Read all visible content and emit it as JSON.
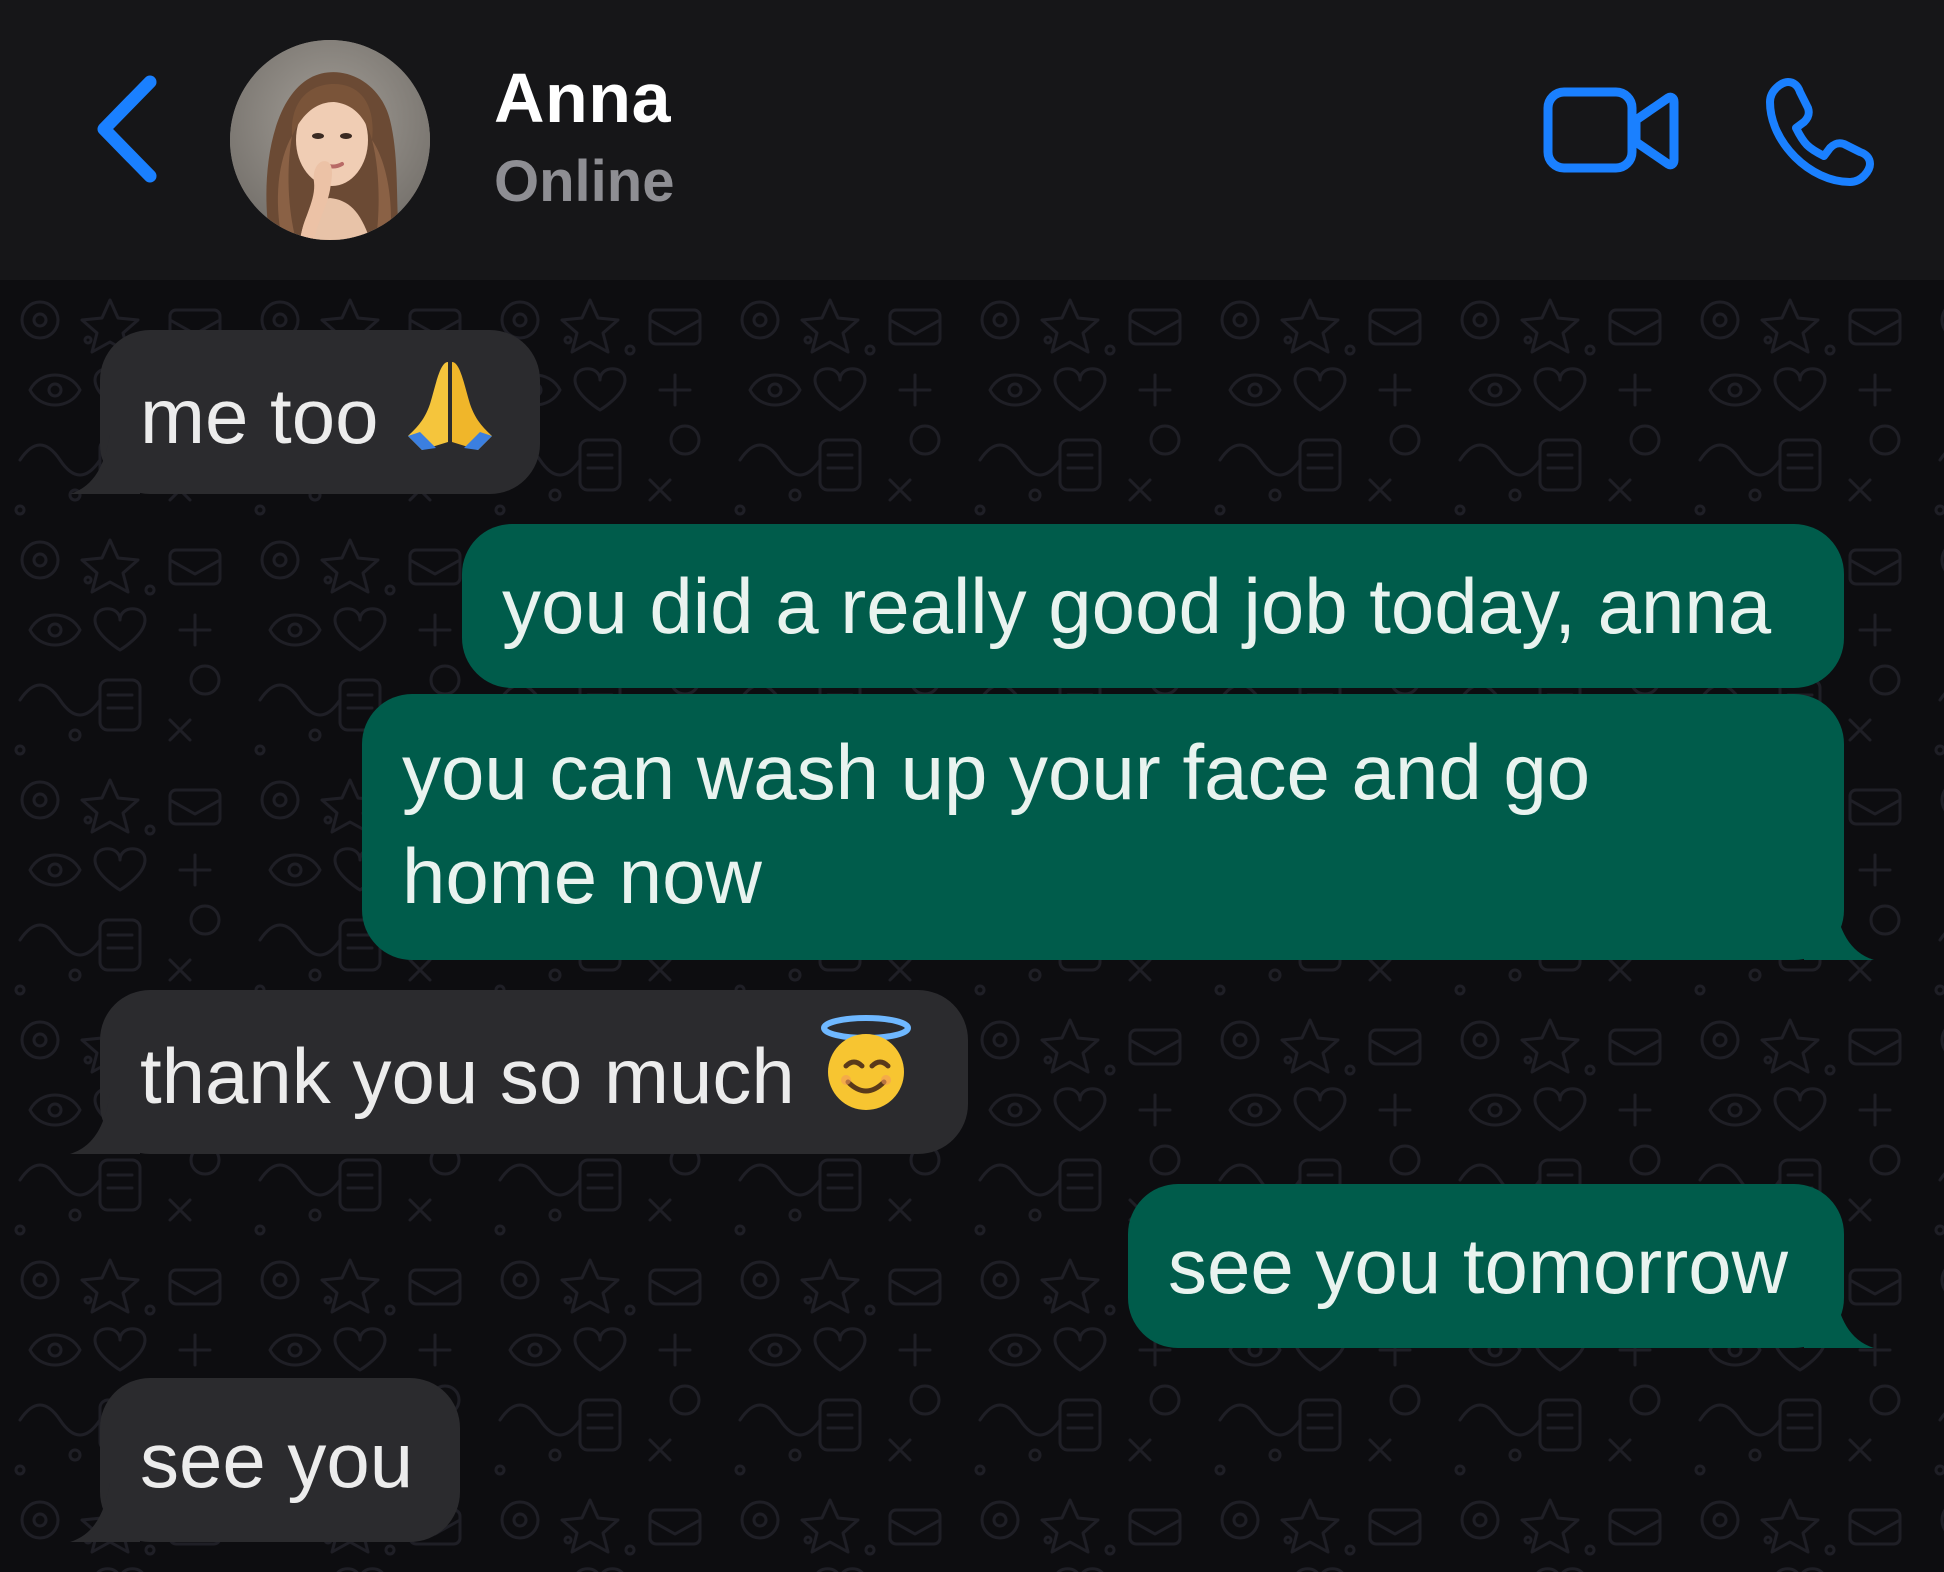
{
  "header": {
    "contact_name": "Anna",
    "status": "Online",
    "back_icon": "chevron-left-icon",
    "video_icon": "video-camera-icon",
    "call_icon": "phone-icon",
    "accent_color": "#1a80ff"
  },
  "messages": [
    {
      "direction": "incoming",
      "text": "me too",
      "emoji": "folded-hands"
    },
    {
      "direction": "outgoing",
      "text": "you did a really good job today, anna"
    },
    {
      "direction": "outgoing",
      "line1": "you can wash up your face and go",
      "line2": "home now"
    },
    {
      "direction": "incoming",
      "text": "thank you so much",
      "emoji": "smiling-face-with-halo"
    },
    {
      "direction": "outgoing",
      "text": "see you tomorrow"
    },
    {
      "direction": "incoming",
      "text": "see you"
    }
  ],
  "colors": {
    "incoming_bubble": "#2b2b2e",
    "outgoing_bubble": "#005c4b",
    "header_bg": "#161618",
    "chat_bg": "#0d0d10",
    "status_text": "#8e8e93"
  }
}
